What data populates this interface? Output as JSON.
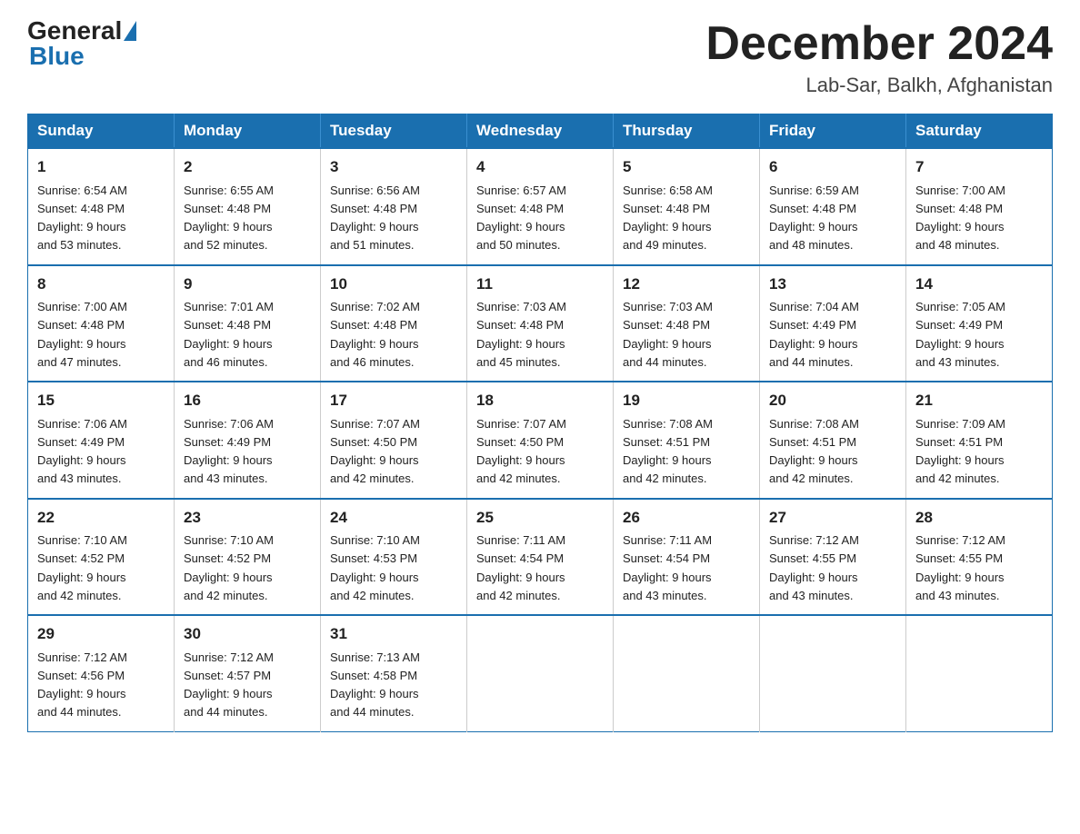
{
  "logo": {
    "general": "General",
    "blue": "Blue"
  },
  "title": "December 2024",
  "subtitle": "Lab-Sar, Balkh, Afghanistan",
  "days_of_week": [
    "Sunday",
    "Monday",
    "Tuesday",
    "Wednesday",
    "Thursday",
    "Friday",
    "Saturday"
  ],
  "weeks": [
    [
      {
        "day": "1",
        "sunrise": "6:54 AM",
        "sunset": "4:48 PM",
        "daylight": "9 hours and 53 minutes."
      },
      {
        "day": "2",
        "sunrise": "6:55 AM",
        "sunset": "4:48 PM",
        "daylight": "9 hours and 52 minutes."
      },
      {
        "day": "3",
        "sunrise": "6:56 AM",
        "sunset": "4:48 PM",
        "daylight": "9 hours and 51 minutes."
      },
      {
        "day": "4",
        "sunrise": "6:57 AM",
        "sunset": "4:48 PM",
        "daylight": "9 hours and 50 minutes."
      },
      {
        "day": "5",
        "sunrise": "6:58 AM",
        "sunset": "4:48 PM",
        "daylight": "9 hours and 49 minutes."
      },
      {
        "day": "6",
        "sunrise": "6:59 AM",
        "sunset": "4:48 PM",
        "daylight": "9 hours and 48 minutes."
      },
      {
        "day": "7",
        "sunrise": "7:00 AM",
        "sunset": "4:48 PM",
        "daylight": "9 hours and 48 minutes."
      }
    ],
    [
      {
        "day": "8",
        "sunrise": "7:00 AM",
        "sunset": "4:48 PM",
        "daylight": "9 hours and 47 minutes."
      },
      {
        "day": "9",
        "sunrise": "7:01 AM",
        "sunset": "4:48 PM",
        "daylight": "9 hours and 46 minutes."
      },
      {
        "day": "10",
        "sunrise": "7:02 AM",
        "sunset": "4:48 PM",
        "daylight": "9 hours and 46 minutes."
      },
      {
        "day": "11",
        "sunrise": "7:03 AM",
        "sunset": "4:48 PM",
        "daylight": "9 hours and 45 minutes."
      },
      {
        "day": "12",
        "sunrise": "7:03 AM",
        "sunset": "4:48 PM",
        "daylight": "9 hours and 44 minutes."
      },
      {
        "day": "13",
        "sunrise": "7:04 AM",
        "sunset": "4:49 PM",
        "daylight": "9 hours and 44 minutes."
      },
      {
        "day": "14",
        "sunrise": "7:05 AM",
        "sunset": "4:49 PM",
        "daylight": "9 hours and 43 minutes."
      }
    ],
    [
      {
        "day": "15",
        "sunrise": "7:06 AM",
        "sunset": "4:49 PM",
        "daylight": "9 hours and 43 minutes."
      },
      {
        "day": "16",
        "sunrise": "7:06 AM",
        "sunset": "4:49 PM",
        "daylight": "9 hours and 43 minutes."
      },
      {
        "day": "17",
        "sunrise": "7:07 AM",
        "sunset": "4:50 PM",
        "daylight": "9 hours and 42 minutes."
      },
      {
        "day": "18",
        "sunrise": "7:07 AM",
        "sunset": "4:50 PM",
        "daylight": "9 hours and 42 minutes."
      },
      {
        "day": "19",
        "sunrise": "7:08 AM",
        "sunset": "4:51 PM",
        "daylight": "9 hours and 42 minutes."
      },
      {
        "day": "20",
        "sunrise": "7:08 AM",
        "sunset": "4:51 PM",
        "daylight": "9 hours and 42 minutes."
      },
      {
        "day": "21",
        "sunrise": "7:09 AM",
        "sunset": "4:51 PM",
        "daylight": "9 hours and 42 minutes."
      }
    ],
    [
      {
        "day": "22",
        "sunrise": "7:10 AM",
        "sunset": "4:52 PM",
        "daylight": "9 hours and 42 minutes."
      },
      {
        "day": "23",
        "sunrise": "7:10 AM",
        "sunset": "4:52 PM",
        "daylight": "9 hours and 42 minutes."
      },
      {
        "day": "24",
        "sunrise": "7:10 AM",
        "sunset": "4:53 PM",
        "daylight": "9 hours and 42 minutes."
      },
      {
        "day": "25",
        "sunrise": "7:11 AM",
        "sunset": "4:54 PM",
        "daylight": "9 hours and 42 minutes."
      },
      {
        "day": "26",
        "sunrise": "7:11 AM",
        "sunset": "4:54 PM",
        "daylight": "9 hours and 43 minutes."
      },
      {
        "day": "27",
        "sunrise": "7:12 AM",
        "sunset": "4:55 PM",
        "daylight": "9 hours and 43 minutes."
      },
      {
        "day": "28",
        "sunrise": "7:12 AM",
        "sunset": "4:55 PM",
        "daylight": "9 hours and 43 minutes."
      }
    ],
    [
      {
        "day": "29",
        "sunrise": "7:12 AM",
        "sunset": "4:56 PM",
        "daylight": "9 hours and 44 minutes."
      },
      {
        "day": "30",
        "sunrise": "7:12 AM",
        "sunset": "4:57 PM",
        "daylight": "9 hours and 44 minutes."
      },
      {
        "day": "31",
        "sunrise": "7:13 AM",
        "sunset": "4:58 PM",
        "daylight": "9 hours and 44 minutes."
      },
      null,
      null,
      null,
      null
    ]
  ],
  "labels": {
    "sunrise": "Sunrise:",
    "sunset": "Sunset:",
    "daylight": "Daylight:"
  },
  "colors": {
    "header_bg": "#1a6faf",
    "header_text": "#ffffff",
    "border": "#1a6faf"
  }
}
